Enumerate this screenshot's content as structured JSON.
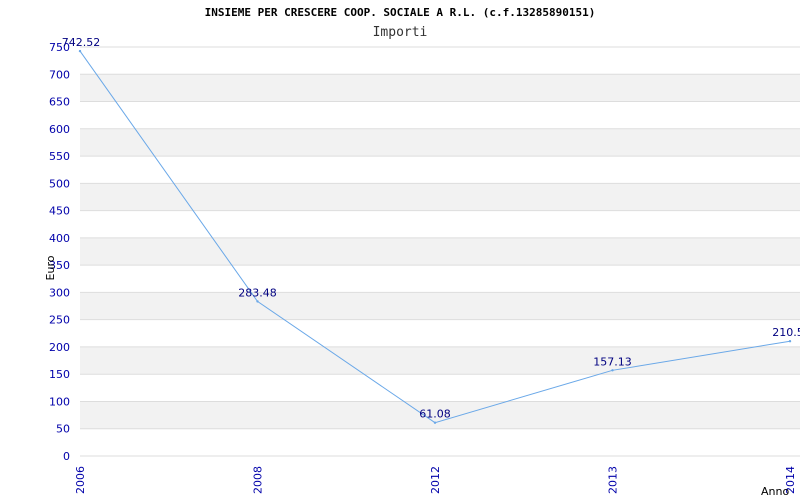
{
  "title": "INSIEME PER CRESCERE COOP. SOCIALE A R.L. (c.f.13285890151)",
  "subtitle": "Importi",
  "colors": {
    "line": "#6aa8e8",
    "band": "#f2f2f2",
    "grid": "#dddddd",
    "tick_text": "#0000aa",
    "data_label": "#000080"
  },
  "chart_data": {
    "type": "line",
    "title": "INSIEME PER CRESCERE COOP. SOCIALE A R.L. (c.f.13285890151)",
    "subtitle": "Importi",
    "xlabel": "Anno",
    "ylabel": "Euro",
    "ylim": [
      0,
      750
    ],
    "ytick_step": 50,
    "grid": true,
    "categories": [
      "2006",
      "2008",
      "2012",
      "2013",
      "2014"
    ],
    "values": [
      742.52,
      283.48,
      61.08,
      157.13,
      210.5
    ],
    "data_labels": [
      "742.52",
      "283.48",
      "61.08",
      "157.13",
      "210.5"
    ]
  }
}
